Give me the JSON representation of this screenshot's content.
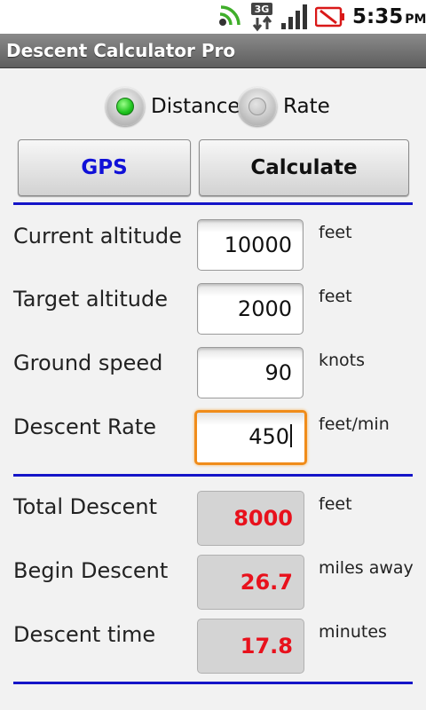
{
  "status_bar": {
    "time": "5:35",
    "ampm": "PM",
    "network": "3G",
    "icons": [
      "wifi-signal-icon",
      "3g-data-icon",
      "cell-signal-icon",
      "battery-alert-icon"
    ]
  },
  "app": {
    "title": "Descent Calculator Pro"
  },
  "mode": {
    "options": [
      {
        "label": "Distance",
        "selected": true
      },
      {
        "label": "Rate",
        "selected": false
      }
    ]
  },
  "buttons": {
    "gps": "GPS",
    "calculate": "Calculate"
  },
  "inputs": [
    {
      "label": "Current altitude",
      "value": "10000",
      "unit": "feet"
    },
    {
      "label": "Target altitude",
      "value": "2000",
      "unit": "feet"
    },
    {
      "label": "Ground speed",
      "value": "90",
      "unit": "knots"
    },
    {
      "label": "Descent Rate",
      "value": "450",
      "unit": "feet/min",
      "focused": true
    }
  ],
  "results": [
    {
      "label": "Total Descent",
      "value": "8000",
      "unit": "feet"
    },
    {
      "label": "Begin Descent",
      "value": "26.7",
      "unit": "miles away"
    },
    {
      "label": "Descent time",
      "value": "17.8",
      "unit": "minutes"
    }
  ],
  "colors": {
    "divider": "#1515c8",
    "gps_text": "#1010d8",
    "result_text": "#e8111c",
    "focus_border": "#f08c1a",
    "radio_selected": "#1ec31e"
  }
}
